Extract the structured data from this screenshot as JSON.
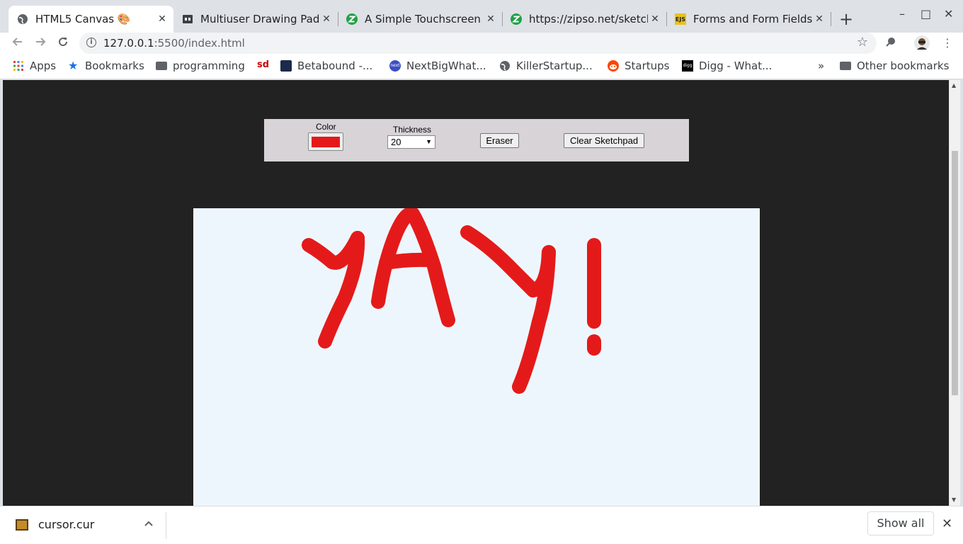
{
  "tabs": [
    {
      "title": "HTML5 Canvas 🎨",
      "close": "✕",
      "icon": "globe-icon"
    },
    {
      "title": "Multiuser Drawing Pad",
      "close": "✕",
      "icon": "codepen-icon"
    },
    {
      "title": "A Simple Touchscreen",
      "close": "✕",
      "icon": "zipso-icon"
    },
    {
      "title": "https://zipso.net/sketch",
      "close": "✕",
      "icon": "zipso-icon"
    },
    {
      "title": "Forms and Form Fields",
      "close": "✕",
      "icon": "ejs-icon",
      "icon_text": "EJS"
    }
  ],
  "new_tab": "+",
  "window_controls": {
    "minimize": "–",
    "maximize": "□",
    "close": "✕"
  },
  "address": {
    "host": "127.0.0.1",
    "path": ":5500/index.html"
  },
  "bookmarks": [
    {
      "label": "Apps",
      "icon": "apps-grid-icon"
    },
    {
      "label": "Bookmarks",
      "icon": "star-icon"
    },
    {
      "label": "programming",
      "icon": "folder-icon"
    },
    {
      "label": "",
      "icon": "sd-icon",
      "icon_text": "sd"
    },
    {
      "label": "Betabound -...",
      "icon": "betabound-icon"
    },
    {
      "label": "NextBigWhat...",
      "icon": "nextbigwhat-icon",
      "icon_text": "next"
    },
    {
      "label": "KillerStartup...",
      "icon": "globe-icon"
    },
    {
      "label": "Startups",
      "icon": "reddit-icon"
    },
    {
      "label": "Digg - What...",
      "icon": "digg-icon",
      "icon_text": "digg"
    }
  ],
  "bookmarks_overflow": "»",
  "other_bookmarks": "Other bookmarks",
  "sketch": {
    "color_label": "Color",
    "color_value": "#e41a1a",
    "thickness_label": "Thickness",
    "thickness_value": "20",
    "eraser_label": "Eraser",
    "clear_label": "Clear Sketchpad",
    "drawing_text": "YAY!"
  },
  "download": {
    "filename": "cursor.cur",
    "show_all": "Show all"
  },
  "colors": {
    "canvas_bg": "#eef6fd",
    "page_bg": "#222222",
    "panel_bg": "#d7d3d7",
    "stroke": "#e41a1a"
  }
}
